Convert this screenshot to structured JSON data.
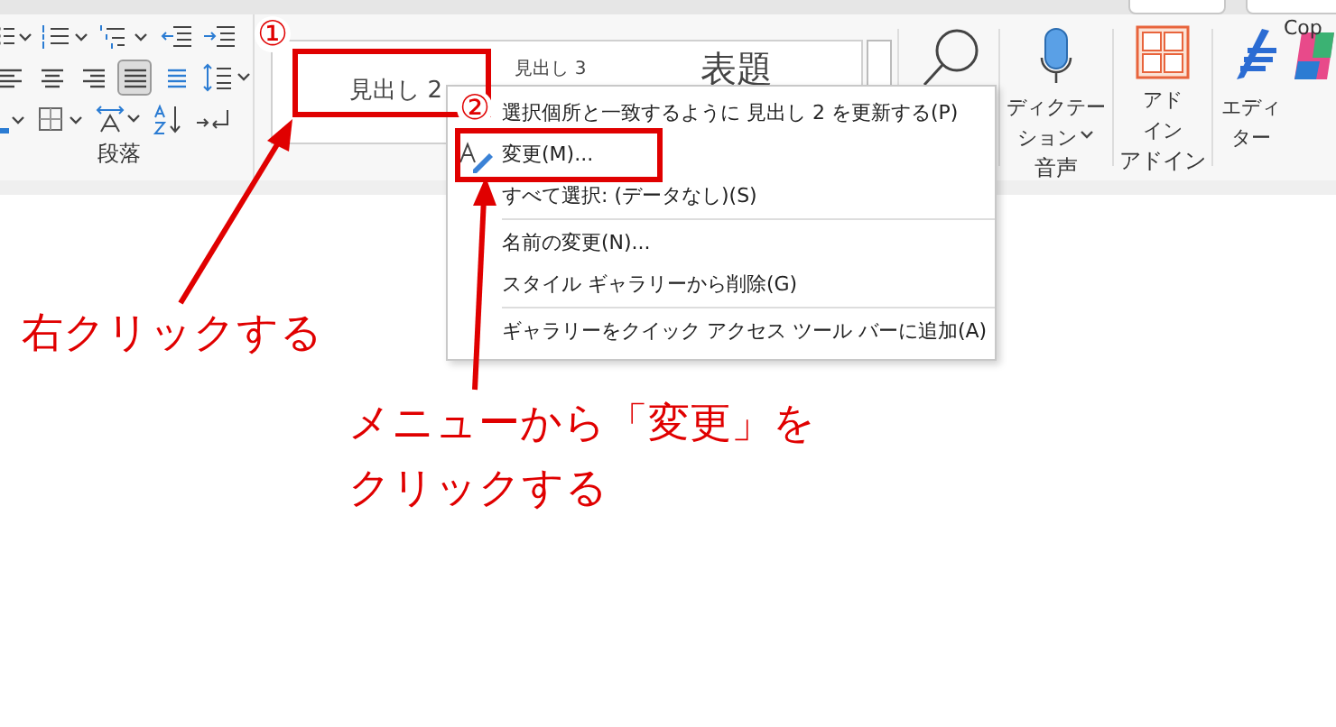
{
  "ribbon": {
    "paragraph_group": {
      "label": "段落",
      "align_buttons": [
        {
          "kind": "left",
          "selected": false
        },
        {
          "kind": "center",
          "selected": false
        },
        {
          "kind": "right",
          "selected": false
        },
        {
          "kind": "justify",
          "selected": true
        },
        {
          "kind": "distributed",
          "selected": false
        }
      ]
    },
    "styles_gallery": [
      {
        "label": "見出し 2",
        "kind": "heading2"
      },
      {
        "label": "見出し 3",
        "kind": "heading3"
      },
      {
        "label": "表題",
        "kind": "title"
      }
    ],
    "voice_group": {
      "button": "ディクテーション",
      "label": "音声"
    },
    "addins_group": {
      "button": "アドイン",
      "label": "アドイン"
    },
    "editor_button": "エディター",
    "copilot_button": "Cop"
  },
  "context_menu": [
    {
      "label": "選択個所と一致するように 見出し 2 を更新する(P)",
      "kind": "plain",
      "separator_before": false
    },
    {
      "label": "変更(M)...",
      "kind": "with-icon",
      "separator_before": false
    },
    {
      "label": "すべて選択: (データなし)(S)",
      "kind": "plain",
      "separator_before": false
    },
    {
      "label": "名前の変更(N)...",
      "kind": "plain",
      "separator_before": true
    },
    {
      "label": "スタイル ギャラリーから削除(G)",
      "kind": "plain",
      "separator_before": false
    },
    {
      "label": "ギャラリーをクイック アクセス ツール バーに追加(A)",
      "kind": "plain",
      "separator_before": true
    }
  ],
  "annotations": {
    "step_markers": [
      "①",
      "②"
    ],
    "notes": [
      {
        "lines": [
          "右クリックする"
        ]
      },
      {
        "lines": [
          "メニューから「変更」を",
          "クリックする"
        ]
      }
    ]
  }
}
